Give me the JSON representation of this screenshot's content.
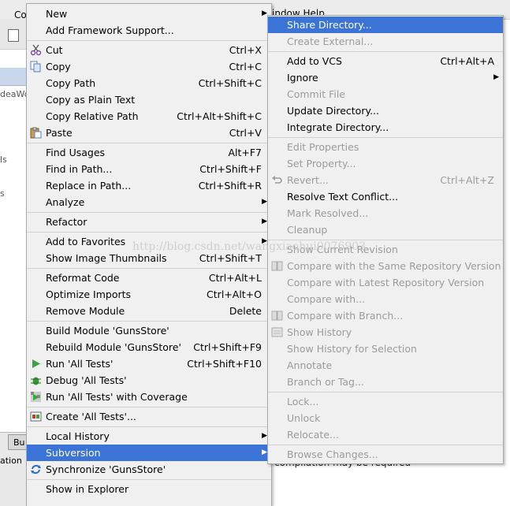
{
  "background": {
    "top_text": "indow   Help",
    "tab_fragment": "Co",
    "side_label_1": "deaWo",
    "side_label_2": "ls",
    "side_label_3": "s",
    "bottom_tab": "Bu",
    "bottom_label": "ation",
    "status_text": "compilation may be required"
  },
  "watermark": "http://blog.csdn.net/wangxiaohui0076903",
  "left_menu": [
    {
      "label": "New",
      "shortcut": "",
      "submenu": true,
      "icon": ""
    },
    {
      "label": "Add Framework Support...",
      "shortcut": "",
      "icon": ""
    },
    {
      "sep": true
    },
    {
      "label": "Cut",
      "shortcut": "Ctrl+X",
      "icon": "scissors-icon"
    },
    {
      "label": "Copy",
      "shortcut": "Ctrl+C",
      "icon": "copy-icon"
    },
    {
      "label": "Copy Path",
      "shortcut": "Ctrl+Shift+C",
      "icon": ""
    },
    {
      "label": "Copy as Plain Text",
      "shortcut": "",
      "icon": ""
    },
    {
      "label": "Copy Relative Path",
      "shortcut": "Ctrl+Alt+Shift+C",
      "icon": ""
    },
    {
      "label": "Paste",
      "shortcut": "Ctrl+V",
      "icon": "paste-icon"
    },
    {
      "sep": true
    },
    {
      "label": "Find Usages",
      "shortcut": "Alt+F7",
      "icon": ""
    },
    {
      "label": "Find in Path...",
      "shortcut": "Ctrl+Shift+F",
      "icon": ""
    },
    {
      "label": "Replace in Path...",
      "shortcut": "Ctrl+Shift+R",
      "icon": ""
    },
    {
      "label": "Analyze",
      "shortcut": "",
      "submenu": true,
      "icon": ""
    },
    {
      "sep": true
    },
    {
      "label": "Refactor",
      "shortcut": "",
      "submenu": true,
      "icon": ""
    },
    {
      "sep": true
    },
    {
      "label": "Add to Favorites",
      "shortcut": "",
      "submenu": true,
      "icon": ""
    },
    {
      "label": "Show Image Thumbnails",
      "shortcut": "Ctrl+Shift+T",
      "icon": ""
    },
    {
      "sep": true
    },
    {
      "label": "Reformat Code",
      "shortcut": "Ctrl+Alt+L",
      "icon": ""
    },
    {
      "label": "Optimize Imports",
      "shortcut": "Ctrl+Alt+O",
      "icon": ""
    },
    {
      "label": "Remove Module",
      "shortcut": "Delete",
      "icon": ""
    },
    {
      "sep": true
    },
    {
      "label": "Build Module 'GunsStore'",
      "shortcut": "",
      "icon": ""
    },
    {
      "label": "Rebuild Module 'GunsStore'",
      "shortcut": "Ctrl+Shift+F9",
      "icon": ""
    },
    {
      "label": "Run 'All Tests'",
      "shortcut": "Ctrl+Shift+F10",
      "icon": "run-icon"
    },
    {
      "label": "Debug 'All Tests'",
      "shortcut": "",
      "icon": "debug-icon"
    },
    {
      "label": "Run 'All Tests' with Coverage",
      "shortcut": "",
      "icon": "coverage-icon"
    },
    {
      "sep": true
    },
    {
      "label": "Create 'All Tests'...",
      "shortcut": "",
      "icon": "create-test-icon"
    },
    {
      "sep": true
    },
    {
      "label": "Local History",
      "shortcut": "",
      "submenu": true,
      "icon": ""
    },
    {
      "label": "Subversion",
      "shortcut": "",
      "submenu": true,
      "selected": true,
      "icon": ""
    },
    {
      "label": "Synchronize 'GunsStore'",
      "shortcut": "",
      "icon": "sync-icon"
    },
    {
      "sep": true
    },
    {
      "label": "Show in Explorer",
      "shortcut": "",
      "icon": ""
    }
  ],
  "right_menu": [
    {
      "label": "Share Directory...",
      "selected": true
    },
    {
      "label": "Create External...",
      "disabled": true
    },
    {
      "sep": true
    },
    {
      "label": "Add to VCS",
      "shortcut": "Ctrl+Alt+A"
    },
    {
      "label": "Ignore",
      "submenu": true
    },
    {
      "label": "Commit File",
      "disabled": true
    },
    {
      "label": "Update Directory..."
    },
    {
      "label": "Integrate Directory..."
    },
    {
      "sep": true
    },
    {
      "label": "Edit Properties",
      "disabled": true
    },
    {
      "label": "Set Property...",
      "disabled": true
    },
    {
      "label": "Revert...",
      "shortcut": "Ctrl+Alt+Z",
      "disabled": true,
      "icon": "revert-icon"
    },
    {
      "label": "Resolve Text Conflict..."
    },
    {
      "label": "Mark Resolved...",
      "disabled": true
    },
    {
      "label": "Cleanup",
      "disabled": true
    },
    {
      "sep": true
    },
    {
      "label": "Show Current Revision",
      "disabled": true
    },
    {
      "label": "Compare with the Same Repository Version",
      "disabled": true,
      "icon": "compare-icon"
    },
    {
      "label": "Compare with Latest Repository Version",
      "disabled": true
    },
    {
      "label": "Compare with...",
      "disabled": true
    },
    {
      "label": "Compare with Branch...",
      "disabled": true,
      "icon": "compare-icon"
    },
    {
      "label": "Show History",
      "disabled": true,
      "icon": "history-icon"
    },
    {
      "label": "Show History for Selection",
      "disabled": true
    },
    {
      "label": "Annotate",
      "disabled": true
    },
    {
      "label": "Branch or Tag...",
      "disabled": true
    },
    {
      "sep": true
    },
    {
      "label": "Lock...",
      "disabled": true
    },
    {
      "label": "Unlock",
      "disabled": true
    },
    {
      "label": "Relocate...",
      "disabled": true
    },
    {
      "sep": true
    },
    {
      "label": "Browse Changes...",
      "disabled": true
    }
  ],
  "colors": {
    "selection": "#3b74d6",
    "menu_bg": "#f0f0f0",
    "disabled": "#9b9b9b"
  }
}
